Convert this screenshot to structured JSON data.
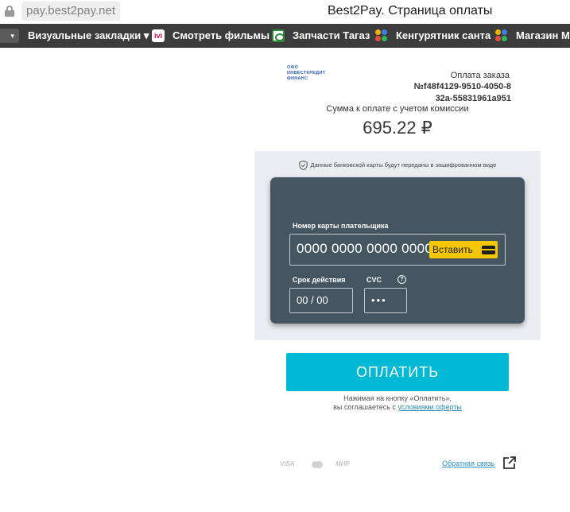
{
  "browser": {
    "url": "pay.best2pay.net",
    "title": "Best2Pay. Страница оплаты"
  },
  "bookmarks": {
    "overflow_label": "▾",
    "items": [
      {
        "label": "Визуальные закладки ▾",
        "icon": "visual-bookmarks"
      },
      {
        "label": "Смотреть фильмы",
        "icon": "ivi-icon",
        "icon_text": "ivi"
      },
      {
        "label": "Запчасти Тагаз",
        "icon": "tagaz-icon"
      },
      {
        "label": "Кенгурятник санта",
        "icon": "dots-icon"
      },
      {
        "label": "Магазин Ма",
        "icon": "dots-icon"
      }
    ]
  },
  "merchant": {
    "logo_lines": [
      "ОФО",
      "ИНВЕСТКРЕДИТ",
      "ФИНАНС"
    ]
  },
  "order": {
    "title": "Оплата заказа",
    "number": "№f48f4129-9510-4050-832a-55831961a951"
  },
  "amount": {
    "caption": "Сумма к оплате с учетом комиссии",
    "value": "695.22 ₽"
  },
  "security_note": "Данные банковской карты будут переданы в зашифрованном виде",
  "card_form": {
    "number_label": "Номер карты плательщика",
    "number_placeholder": "0000 0000 0000 0000",
    "paste_label": "Вставить",
    "expiry_label": "Срок действия",
    "expiry_placeholder": "00 / 00",
    "cvc_label": "CVC",
    "cvc_placeholder": "•••",
    "help_symbol": "?"
  },
  "pay_button": "ОПЛАТИТЬ",
  "agreement": {
    "line1": "Нажимая на кнопку «Оплатить»,",
    "line2_prefix": "вы соглашаетесь с ",
    "link": "условиями оферты"
  },
  "footer": {
    "visa": "VISA",
    "mir": "МИР",
    "feedback": "Обратная связь"
  },
  "colors": {
    "accent": "#00b9d5",
    "card": "#455661",
    "paste": "#f6c700"
  }
}
